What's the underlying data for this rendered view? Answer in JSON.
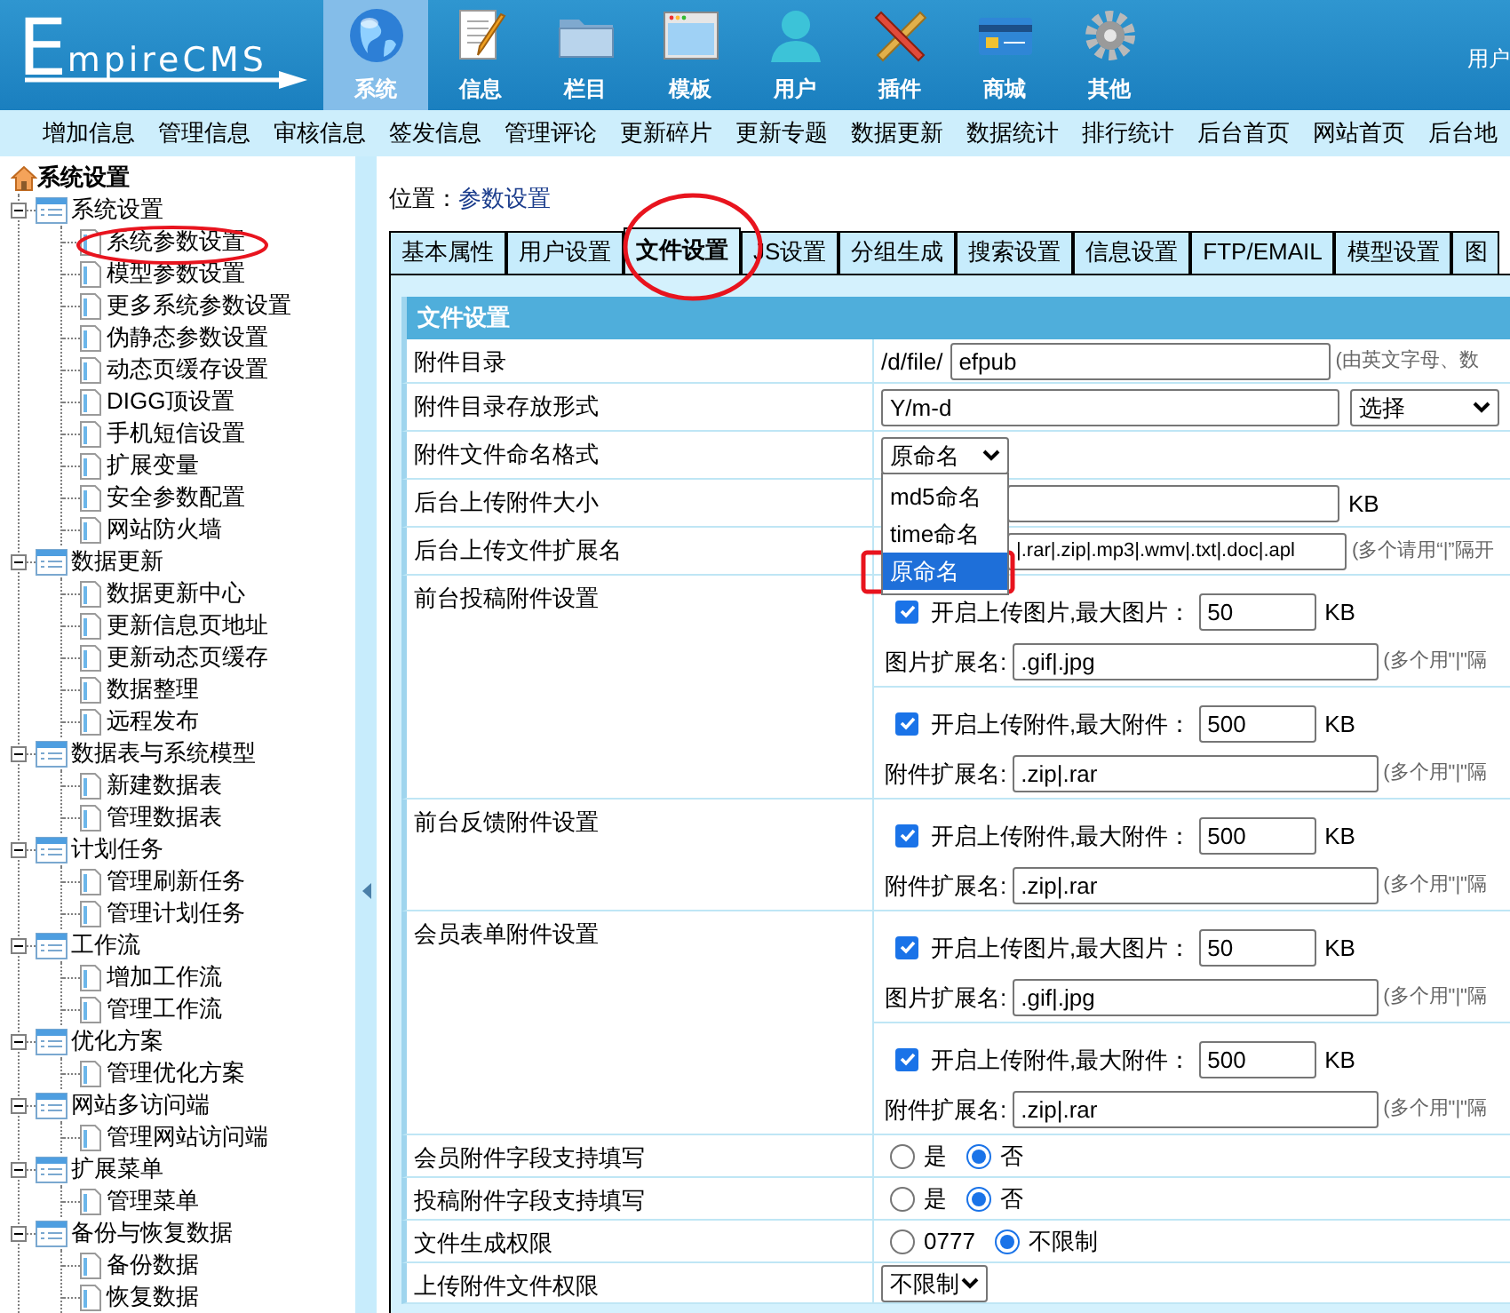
{
  "logo": {
    "text": "EmpireCMS"
  },
  "nav": [
    {
      "label": "系统",
      "kind": "globe",
      "selected": true
    },
    {
      "label": "信息",
      "kind": "document",
      "selected": false
    },
    {
      "label": "栏目",
      "kind": "folder",
      "selected": false
    },
    {
      "label": "模板",
      "kind": "window",
      "selected": false
    },
    {
      "label": "用户",
      "kind": "person",
      "selected": false
    },
    {
      "label": "插件",
      "kind": "tools",
      "selected": false
    },
    {
      "label": "商城",
      "kind": "card",
      "selected": false
    },
    {
      "label": "其他",
      "kind": "gear",
      "selected": false
    }
  ],
  "user_link": "用户",
  "submenu": [
    "增加信息",
    "管理信息",
    "审核信息",
    "签发信息",
    "管理评论",
    "更新碎片",
    "更新专题",
    "数据更新",
    "数据统计",
    "排行统计",
    "后台首页",
    "网站首页",
    "后台地"
  ],
  "sidebar": {
    "title": "系统设置",
    "groups": [
      {
        "label": "系统设置",
        "expanded": true,
        "children": [
          {
            "label": "系统参数设置"
          },
          {
            "label": "模型参数设置"
          },
          {
            "label": "更多系统参数设置"
          },
          {
            "label": "伪静态参数设置"
          },
          {
            "label": "动态页缓存设置"
          },
          {
            "label": "DIGG顶设置"
          },
          {
            "label": "手机短信设置"
          },
          {
            "label": "扩展变量"
          },
          {
            "label": "安全参数配置"
          },
          {
            "label": "网站防火墙"
          }
        ]
      },
      {
        "label": "数据更新",
        "expanded": true,
        "children": [
          {
            "label": "数据更新中心"
          },
          {
            "label": "更新信息页地址"
          },
          {
            "label": "更新动态页缓存"
          },
          {
            "label": "数据整理"
          },
          {
            "label": "远程发布"
          }
        ]
      },
      {
        "label": "数据表与系统模型",
        "expanded": true,
        "children": [
          {
            "label": "新建数据表"
          },
          {
            "label": "管理数据表"
          }
        ]
      },
      {
        "label": "计划任务",
        "expanded": true,
        "children": [
          {
            "label": "管理刷新任务"
          },
          {
            "label": "管理计划任务"
          }
        ]
      },
      {
        "label": "工作流",
        "expanded": true,
        "children": [
          {
            "label": "增加工作流"
          },
          {
            "label": "管理工作流"
          }
        ]
      },
      {
        "label": "优化方案",
        "expanded": true,
        "children": [
          {
            "label": "管理优化方案"
          }
        ]
      },
      {
        "label": "网站多访问端",
        "expanded": true,
        "children": [
          {
            "label": "管理网站访问端"
          }
        ]
      },
      {
        "label": "扩展菜单",
        "expanded": true,
        "children": [
          {
            "label": "管理菜单"
          }
        ]
      },
      {
        "label": "备份与恢复数据",
        "expanded": true,
        "children": [
          {
            "label": "备份数据"
          },
          {
            "label": "恢复数据"
          }
        ]
      }
    ]
  },
  "breadcrumb": {
    "label": "位置：",
    "value": "参数设置"
  },
  "tabs": [
    {
      "label": "基本属性",
      "selected": false
    },
    {
      "label": "用户设置",
      "selected": false
    },
    {
      "label": "文件设置",
      "selected": true
    },
    {
      "label": "JS设置",
      "selected": false
    },
    {
      "label": "分组生成",
      "selected": false
    },
    {
      "label": "搜索设置",
      "selected": false
    },
    {
      "label": "信息设置",
      "selected": false
    },
    {
      "label": "FTP/EMAIL",
      "selected": false
    },
    {
      "label": "模型设置",
      "selected": false
    },
    {
      "label": "图",
      "selected": false
    }
  ],
  "section_title": "文件设置",
  "rows": [
    {
      "label": "附件目录",
      "kind": "prefixed",
      "prefix": "/d/file/",
      "value": "efpub",
      "hint": "(由英文字母、数"
    },
    {
      "label": "附件目录存放形式",
      "kind": "inputselect",
      "value": "Y/m-d",
      "select": "选择"
    },
    {
      "label": "附件文件命名格式",
      "kind": "dropdown",
      "value": "原命名",
      "options": [
        {
          "label": "md5命名",
          "selected": false
        },
        {
          "label": "time命名",
          "selected": false
        },
        {
          "label": "原命名",
          "selected": true
        }
      ]
    },
    {
      "label": "后台上传附件大小",
      "kind": "unit",
      "unit": "KB"
    },
    {
      "label": "后台上传文件扩展名",
      "kind": "hinted",
      "value": "|.rar|.zip|.mp3|.wmv|.txt|.doc|.apl",
      "hint": "(多个请用“|”隔开"
    },
    {
      "label": "前台投稿附件设置",
      "kind": "uploads",
      "blocks": [
        {
          "checked": true,
          "label": "开启上传图片,最大图片：",
          "size": "50",
          "unit": "KB",
          "ext_label": "图片扩展名:",
          "ext": ".gif|.jpg",
          "hint": "(多个用\"|\"隔"
        },
        {
          "checked": true,
          "label": "开启上传附件,最大附件：",
          "size": "500",
          "unit": "KB",
          "ext_label": "附件扩展名:",
          "ext": ".zip|.rar",
          "hint": "(多个用\"|\"隔"
        }
      ]
    },
    {
      "label": "前台反馈附件设置",
      "kind": "uploads",
      "blocks": [
        {
          "checked": true,
          "label": "开启上传附件,最大附件：",
          "size": "500",
          "unit": "KB",
          "ext_label": "附件扩展名:",
          "ext": ".zip|.rar",
          "hint": "(多个用\"|\"隔"
        }
      ]
    },
    {
      "label": "会员表单附件设置",
      "kind": "uploads",
      "blocks": [
        {
          "checked": true,
          "label": "开启上传图片,最大图片：",
          "size": "50",
          "unit": "KB",
          "ext_label": "图片扩展名:",
          "ext": ".gif|.jpg",
          "hint": "(多个用\"|\"隔"
        },
        {
          "checked": true,
          "label": "开启上传附件,最大附件：",
          "size": "500",
          "unit": "KB",
          "ext_label": "附件扩展名:",
          "ext": ".zip|.rar",
          "hint": "(多个用\"|\"隔"
        }
      ]
    },
    {
      "label": "会员附件字段支持填写",
      "kind": "radio",
      "options": [
        {
          "label": "是",
          "selected": false
        },
        {
          "label": "否",
          "selected": true
        }
      ]
    },
    {
      "label": "投稿附件字段支持填写",
      "kind": "radio",
      "options": [
        {
          "label": "是",
          "selected": false
        },
        {
          "label": "否",
          "selected": true
        }
      ]
    },
    {
      "label": "文件生成权限",
      "kind": "radio",
      "options": [
        {
          "label": "0777",
          "selected": false
        },
        {
          "label": "不限制",
          "selected": true
        }
      ]
    },
    {
      "label": "上传附件文件权限",
      "kind": "select",
      "value": "不限制"
    }
  ]
}
